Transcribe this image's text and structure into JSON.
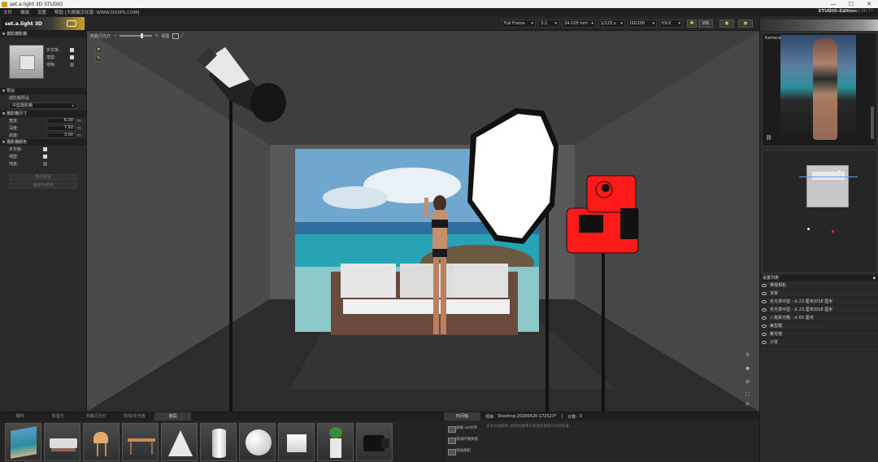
{
  "window": {
    "title": "set.a.light 3D STUDIO",
    "controls": [
      "—",
      "☐",
      "✕"
    ]
  },
  "menubar": {
    "items": [
      "文件",
      "编辑",
      "设置",
      "帮助 [大眼摄汉化版: WWW.DXXPS.COM]"
    ],
    "edition": "STUDIO-Edition",
    "version": "v2.00.77"
  },
  "logo": {
    "text": "set.a.light 3D"
  },
  "toolbar": {
    "frame": "Full Frame",
    "ratio": "3:2",
    "lens": "24-105 mm",
    "shutter": "1/125 s",
    "iso": "ISO100",
    "aperture": "f/9.0",
    "wb": "WB"
  },
  "viewport_toolbar": {
    "label_left": "热靴闪光灯",
    "label_right": "视图"
  },
  "left_panel": {
    "studio_title": "摄影棚影棚",
    "thumb_options": [
      {
        "label": "天花板:",
        "checked": true
      },
      {
        "label": "墙壁:",
        "checked": true
      },
      {
        "label": "地板:",
        "checked": false
      }
    ],
    "preset_title": "预设",
    "preset_label": "摄影棚预设",
    "preset_value": "中型摄影棚",
    "size_title": "摄影棚尺寸",
    "sizes": [
      {
        "label": "宽度:",
        "value": "6.00",
        "unit": "m"
      },
      {
        "label": "深度:",
        "value": "7.50",
        "unit": "m"
      },
      {
        "label": "高度:",
        "value": "3.00",
        "unit": "m"
      }
    ],
    "color_title": "摄影棚颜色",
    "colors": [
      {
        "label": "天花板:",
        "checked": true
      },
      {
        "label": "墙壁:",
        "checked": true
      },
      {
        "label": "地板:",
        "checked": false
      }
    ],
    "buttons": [
      "修改预设",
      "保存为常用"
    ]
  },
  "right_panel": {
    "camera_label": "Kamera",
    "settings_title": "设置列表",
    "settings_items": [
      "带视相机",
      "背景",
      "反光罩中型 - ⊘ 23 厘米/D18 厘米",
      "反光罩中型 - ⊘ 23 厘米/D18 厘米",
      "八角柔光箱 - ⊘ 65 厘米",
      "美型模",
      "聚光墙",
      "沙发"
    ]
  },
  "library": {
    "tabs": [
      "模特",
      "影室灯",
      "热靴闪光灯",
      "附加/反光板",
      "道具"
    ],
    "active_tab": 4,
    "items": [
      "background-prop",
      "sofa-prop",
      "chair-prop",
      "table-prop",
      "cone-prop",
      "cylinder-prop",
      "sphere-prop",
      "cube-prop",
      "plant-prop",
      "camera-prop"
    ]
  },
  "timeline": {
    "tab": "时间轴",
    "project_label": "项目:",
    "project_value": "Shooting-20200420-172523*",
    "count_label": "计数:",
    "count_value": "0",
    "buttons": [
      "加载 set文件",
      "添加环境快照",
      "添加相机"
    ],
    "hint": "还未为拍照目, 此时间轴用于快速切换各灯光的布置。"
  },
  "colors": {
    "accent": "#f2c94c",
    "camera_red": "#ff1a1a",
    "background": "#2b2b2b"
  }
}
